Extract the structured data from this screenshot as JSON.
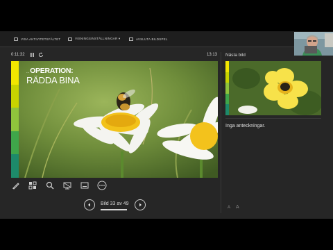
{
  "toolbar": {
    "show_taskbar": "VISA AKTIVITETSFÄLTET",
    "display_settings": "VISNINGSINSTÄLLNINGAR ▾",
    "end_show": "AVSLUTA BILDSPEL"
  },
  "timer": {
    "elapsed": "0:11:32",
    "clock": "13:13"
  },
  "slide": {
    "title_line1": "OPERATION:",
    "title_line2": "RÄDDA BINA",
    "title_prefix": "..."
  },
  "next_slide_label": "Nästa bild",
  "notes_text": "Inga anteckningar.",
  "navigation": {
    "counter": "Bild 33 av 49"
  },
  "accent_stripes": [
    "#f2e600",
    "#c8d400",
    "#8fc43c",
    "#3fa64a",
    "#1d8a6a"
  ],
  "icons": [
    "pen-icon",
    "slides-grid-icon",
    "zoom-icon",
    "display-icon",
    "subtitles-icon",
    "more-icon",
    "timer-pause-icon",
    "timer-reset-icon"
  ]
}
